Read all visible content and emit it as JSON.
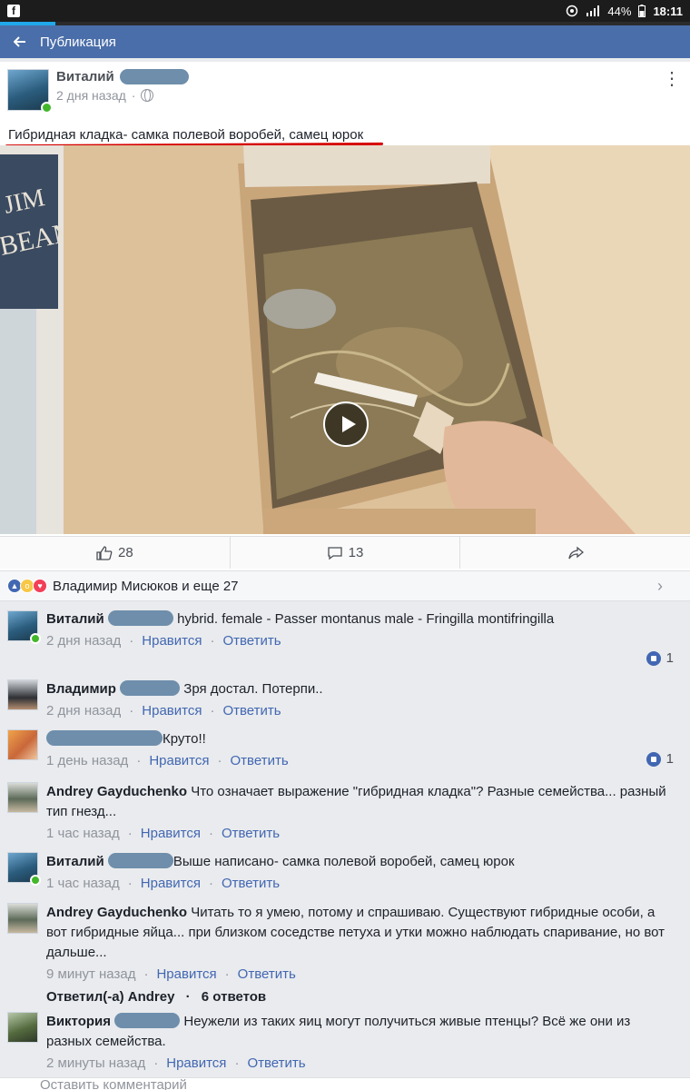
{
  "status_bar": {
    "battery": "44%",
    "time": "18:11"
  },
  "colors": {
    "brand": "#4a6ea9",
    "link": "#4267b2",
    "online": "#42b72a",
    "annotation": "#d60000"
  },
  "progress": {
    "fraction": 0.08
  },
  "app_bar": {
    "back_icon": "arrow-left-icon",
    "title": "Публикация"
  },
  "post": {
    "author": "Виталий",
    "time": "2 дня назад",
    "separator": "·",
    "privacy_icon": "globe-icon",
    "text": "Гибридная кладка- самка полевой воробей, самец юрок",
    "media_type": "video",
    "actions": {
      "likes": "28",
      "comments": "13"
    }
  },
  "reactions": {
    "icons": [
      "like-icon",
      "wow-icon",
      "love-icon"
    ],
    "names": "Владимир Мисюков и еще 27"
  },
  "comments": [
    {
      "name": "Виталий",
      "text": "hybrid. female - Passer montanus male -  Fringilla montifringilla",
      "time": "2 дня назад",
      "like": "Нравится",
      "reply": "Ответить",
      "like_count": "1"
    },
    {
      "name": "Владимир",
      "text": "Зря достал. Потерпи..",
      "time": "2 дня назад",
      "like": "Нравится",
      "reply": "Ответить",
      "like_count": ""
    },
    {
      "name": "",
      "text": "Круто!!",
      "time": "1 день назад",
      "like": "Нравится",
      "reply": "Ответить",
      "like_count": "1"
    },
    {
      "name": "Andrey Gayduchenko",
      "text": "Что означает выражение \"гибридная кладка\"? Разные семейства... разный тип гнезд...",
      "time": "1 час назад",
      "like": "Нравится",
      "reply": "Ответить",
      "like_count": ""
    },
    {
      "name": "Виталий",
      "text": "Выше написано- самка полевой воробей, самец юрок",
      "time": "1 час назад",
      "like": "Нравится",
      "reply": "Ответить",
      "like_count": ""
    },
    {
      "name": "Andrey Gayduchenko",
      "text": "Читать то я умею, потому и спрашиваю. Существуют гибридные особи, а вот гибридные яйца... при близком соседстве петуха и утки можно наблюдать  спаривание, но вот дальше...",
      "time": "9 минут назад",
      "like": "Нравится",
      "reply": "Ответить",
      "like_count": "",
      "replies_prefix": "Ответил(-а) Andrey",
      "replies_count": "6 ответов"
    },
    {
      "name": "Виктория",
      "text": "Неужели из таких яиц могут получиться живые птенцы? Всё же они из разных семейства.",
      "time": "2 минуты назад",
      "like": "Нравится",
      "reply": "Ответить",
      "like_count": ""
    }
  ],
  "composer": {
    "placeholder": "Оставить комментарий"
  }
}
